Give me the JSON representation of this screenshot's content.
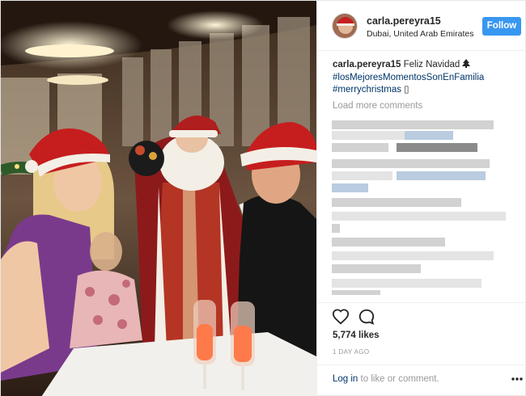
{
  "post": {
    "username": "carla.pereyra15",
    "location": "Dubai, United Arab Emirates",
    "follow_label": "Follow"
  },
  "caption": {
    "user": "carla.pereyra15",
    "text": "Feliz Navidad",
    "icon": "christmas-tree-icon",
    "hashtag1": "#losMejoresMomentosSonEnFamilia",
    "hashtag2": "#merrychristmas",
    "trailing_glyph": "▯"
  },
  "comments": {
    "load_more_label": "Load more comments"
  },
  "actions": {
    "like_icon": "heart-icon",
    "comment_icon": "comment-icon"
  },
  "likes_text": "5,774 likes",
  "timestamp": "1 DAY AGO",
  "footer": {
    "login_label": "Log in",
    "rest_label": " to like or comment.",
    "more_icon": "more-options-icon"
  },
  "colors": {
    "follow_blue": "#3897f0",
    "link_blue": "#003569",
    "muted_gray": "#999999"
  }
}
